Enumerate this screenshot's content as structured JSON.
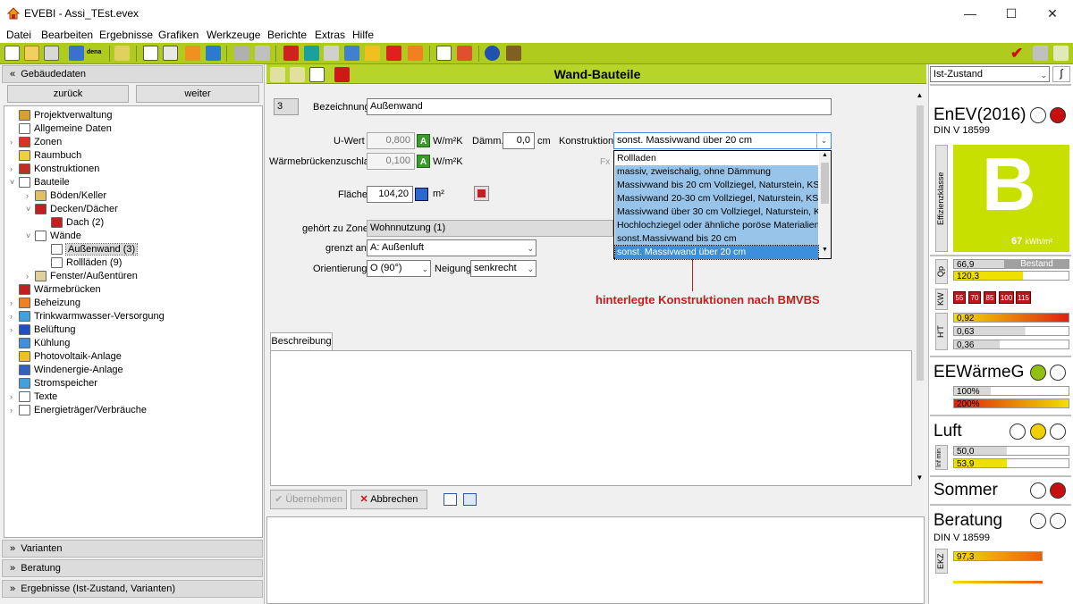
{
  "window": {
    "title": "EVEBI - Assi_TEst.evex",
    "min": "—",
    "max": "☐",
    "close": "✕"
  },
  "menu": [
    "Datei",
    "Bearbeiten",
    "Ergebnisse",
    "Grafiken",
    "Werkzeuge",
    "Berichte",
    "Extras",
    "Hilfe"
  ],
  "toolbar": {
    "dena": "dena"
  },
  "left": {
    "section_title": "Gebäudedaten",
    "back": "zurück",
    "forward": "weiter",
    "tree": [
      {
        "label": "Projektverwaltung",
        "level": 1,
        "exp": ""
      },
      {
        "label": "Allgemeine Daten",
        "level": 1,
        "exp": ""
      },
      {
        "label": "Zonen",
        "level": 1,
        "exp": "›"
      },
      {
        "label": "Raumbuch",
        "level": 1,
        "exp": ""
      },
      {
        "label": "Konstruktionen",
        "level": 1,
        "exp": "›"
      },
      {
        "label": "Bauteile",
        "level": 1,
        "exp": "˅"
      },
      {
        "label": "Böden/Keller",
        "level": 2,
        "exp": "›"
      },
      {
        "label": "Decken/Dächer",
        "level": 2,
        "exp": "˅"
      },
      {
        "label": "Dach (2)",
        "level": 3,
        "exp": ""
      },
      {
        "label": "Wände",
        "level": 2,
        "exp": "˅"
      },
      {
        "label": "Außenwand (3)",
        "level": 3,
        "exp": "",
        "selected": true
      },
      {
        "label": "Rollläden (9)",
        "level": 3,
        "exp": ""
      },
      {
        "label": "Fenster/Außentüren",
        "level": 2,
        "exp": "›"
      },
      {
        "label": "Wärmebrücken",
        "level": 1,
        "exp": ""
      },
      {
        "label": "Beheizung",
        "level": 1,
        "exp": "›"
      },
      {
        "label": "Trinkwarmwasser-Versorgung",
        "level": 1,
        "exp": "›"
      },
      {
        "label": "Belüftung",
        "level": 1,
        "exp": "›"
      },
      {
        "label": "Kühlung",
        "level": 1,
        "exp": ""
      },
      {
        "label": "Photovoltaik-Anlage",
        "level": 1,
        "exp": ""
      },
      {
        "label": "Windenergie-Anlage",
        "level": 1,
        "exp": ""
      },
      {
        "label": "Stromspeicher",
        "level": 1,
        "exp": ""
      },
      {
        "label": "Texte",
        "level": 1,
        "exp": "›"
      },
      {
        "label": "Energieträger/Verbräuche",
        "level": 1,
        "exp": "›"
      }
    ],
    "sections_bottom": [
      "Varianten",
      "Beratung",
      "Ergebnisse (Ist-Zustand, Varianten)"
    ]
  },
  "center": {
    "title": "Wand-Bauteile",
    "number": "3",
    "bezeichnung_label": "Bezeichnung",
    "bezeichnung_value": "Außenwand",
    "uwert_label": "U-Wert",
    "uwert_value": "0,800",
    "unit_w": "W/m²K",
    "daemm_label": "Dämm.",
    "daemm_value": "0,0",
    "daemm_unit": "cm",
    "konstruktion_label": "Konstruktion",
    "konstruktion_value": "sonst. Massivwand über 20 cm",
    "wbz_label": "Wärmebrückenzuschlag",
    "wbz_value": "0,100",
    "fx": "Fx",
    "flaeche_label": "Fläche",
    "flaeche_value": "104,20",
    "flaeche_unit": "m²",
    "zone_label": "gehört zu Zone",
    "zone_value": "Wohnnutzung (1)",
    "grenzt_label": "grenzt an",
    "grenzt_value": "A: Außenluft",
    "orient_label": "Orientierung",
    "orient_value": "O (90°)",
    "neigung_label": "Neigung",
    "neigung_value": "senkrecht",
    "dropdown_items": [
      "Rollladen",
      "massiv, zweischalig, ohne Dämmung",
      "Massivwand bis 20 cm Vollziegel, Naturstein, KS",
      "Massivwand 20-30 cm Vollziegel, Naturstein, KS",
      "Massivwand über 30 cm Vollziegel, Naturstein, KS",
      "Hochlochziegel oder ähnliche poröse Materialien",
      "sonst.Massivwand bis 20 cm",
      "sonst. Massivwand über 20 cm"
    ],
    "annotation": "hinterlegte Konstruktionen nach BMVBS",
    "desc_tab": "Beschreibung",
    "apply": "Übernehmen",
    "cancel": "Abbrechen"
  },
  "right": {
    "state": "Ist-Zustand",
    "enev_title": "EnEV(2016)",
    "enev_sub": "DIN V 18599",
    "eff_label": "Effizienzklasse",
    "eff_class": "B",
    "eff_value": "67",
    "eff_unit": "kWh/m²",
    "qp_label": "Qp",
    "qp_values": [
      "66,9",
      "120,3"
    ],
    "qp_state": "Bestand",
    "kw_label": "KW",
    "kw_values": [
      "55",
      "70",
      "85",
      "100",
      "115"
    ],
    "ht_label": "H'T",
    "ht_values": [
      "0,92",
      "0,63",
      "0,36"
    ],
    "ee_title": "EEWärmeG",
    "ee_values": [
      "100%",
      "200%"
    ],
    "luft_title": "Luft",
    "luft_label": "Inf min",
    "luft_values": [
      "50,0",
      "53,9"
    ],
    "sommer_title": "Sommer",
    "beratung_title": "Beratung",
    "beratung_sub": "DIN V 18599",
    "ekz_label": "EKZ",
    "ekz_value": "97,3"
  }
}
